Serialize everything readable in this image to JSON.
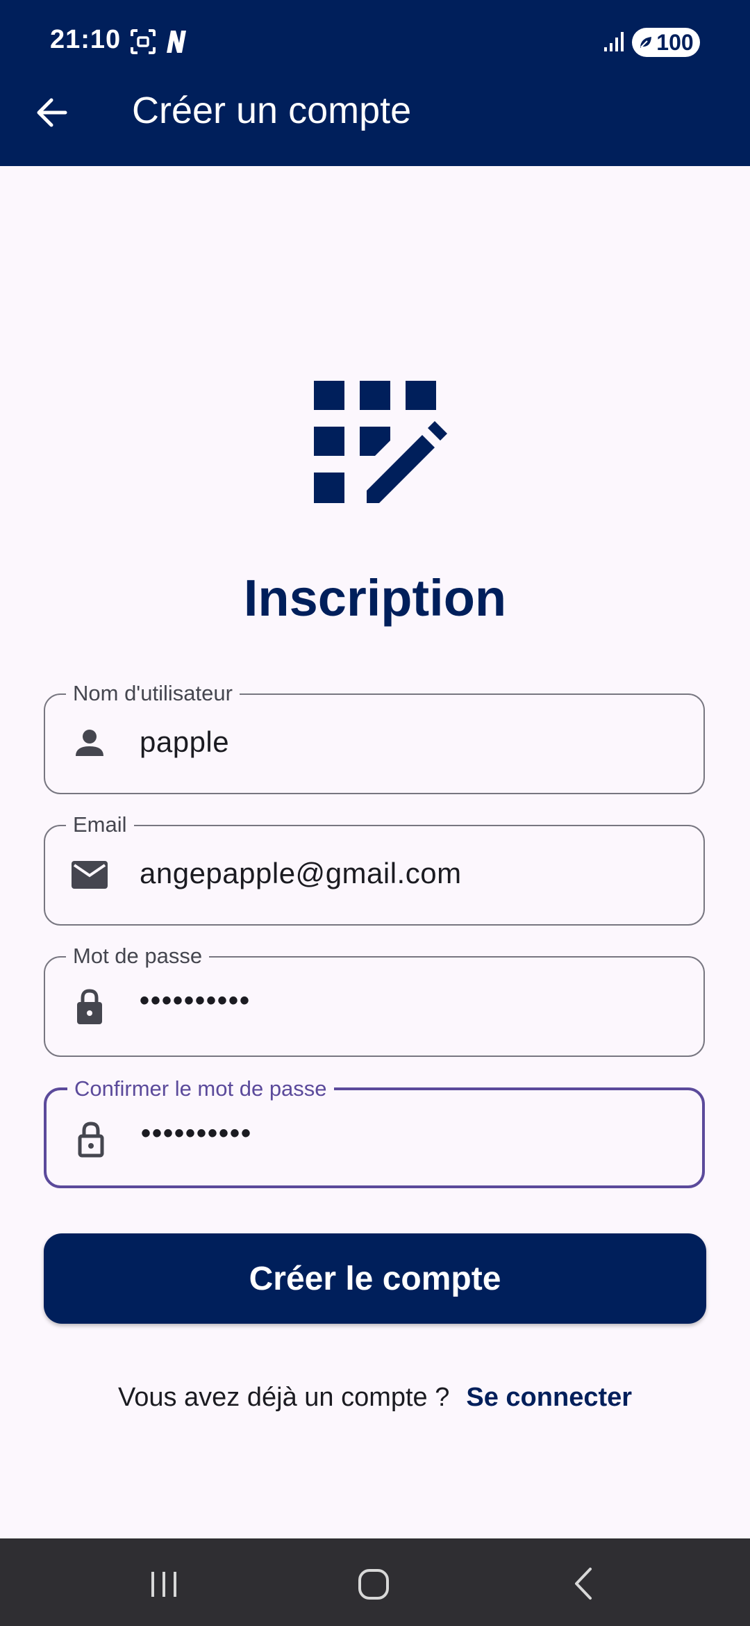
{
  "status_bar": {
    "time": "21:10",
    "battery": "100"
  },
  "app_bar": {
    "title": "Créer un compte"
  },
  "heading": "Inscription",
  "form": {
    "username": {
      "label": "Nom d'utilisateur",
      "value": "papple",
      "icon": "person-icon"
    },
    "email": {
      "label": "Email",
      "value": "angepapple@gmail.com",
      "icon": "mail-icon"
    },
    "password": {
      "label": "Mot de passe",
      "value": "••••••••••",
      "icon": "lock-icon"
    },
    "confirm_password": {
      "label": "Confirmer le mot de passe",
      "value": "••••••••••",
      "icon": "lock-outline-icon"
    }
  },
  "submit_button": "Créer le compte",
  "footer": {
    "prompt": "Vous avez déjà un compte ?",
    "link": "Se connecter"
  },
  "colors": {
    "primary": "#001f5b",
    "focus": "#5b4a9b",
    "background": "#fcf7fd"
  }
}
